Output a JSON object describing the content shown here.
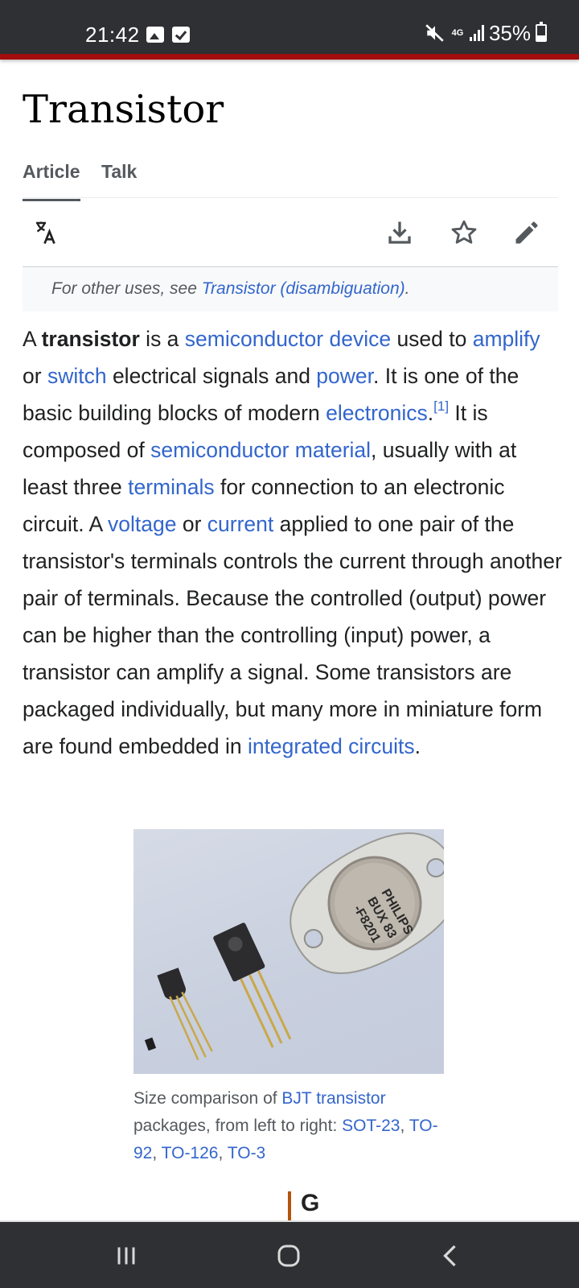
{
  "status_bar": {
    "time": "21:42",
    "network": "4G",
    "battery": "35%",
    "battery_level": 0.35
  },
  "page": {
    "title": "Transistor",
    "tabs": [
      {
        "label": "Article",
        "active": true
      },
      {
        "label": "Talk",
        "active": false
      }
    ],
    "toolbar": {
      "language_icon": "translate-icon",
      "download_icon": "download-icon",
      "watch_icon": "star-icon",
      "edit_icon": "pencil-icon"
    },
    "hatnote": {
      "prefix": "For other uses, see ",
      "link": "Transistor (disambiguation)",
      "suffix": "."
    }
  },
  "intro": {
    "t1": "A ",
    "bold": "transistor",
    "t2": " is a ",
    "l_semiconductor_device": "semiconductor device",
    "t3": " used to ",
    "l_amplify": "amplify",
    "t4": " or ",
    "l_switch": "switch",
    "t5": " electrical signals and ",
    "l_power": "power",
    "t6": ". It is one of the basic building blocks of modern ",
    "l_electronics": "electronics",
    "t7": ".",
    "ref": "[1]",
    "t8": " It is composed of ",
    "l_semiconductor_material": "semiconductor material",
    "t9": ", usually with at least three ",
    "l_terminals": "terminals",
    "t10": " for connection to an electronic circuit. A ",
    "l_voltage": "voltage",
    "t11": " or ",
    "l_current": "current",
    "t12": " applied to one pair of the transistor's terminals controls the current through another pair of terminals. Because the controlled (output) power can be higher than the controlling (input) power, a transistor can amplify a signal. Some transistors are packaged individually, but many more in miniature form are found embedded in ",
    "l_integrated_circuits": "integrated circuits",
    "t13": "."
  },
  "figure": {
    "image_text": {
      "brand": "PHILIPS",
      "model": "BUX 83",
      "code": "-F8201"
    },
    "caption": {
      "c1": "Size comparison of ",
      "l_bjt": "BJT transistor",
      "c2": " packages, from left to right: ",
      "l_sot23": "SOT-23",
      "c3": ", ",
      "l_to92": "TO-92",
      "c4": ", ",
      "l_to126": "TO-126",
      "c5": ", ",
      "l_to3": "TO-3"
    }
  },
  "partial_next": "G",
  "nav_bar": {
    "recents_icon": "recents-icon",
    "home_icon": "home-icon",
    "back_icon": "back-icon"
  }
}
